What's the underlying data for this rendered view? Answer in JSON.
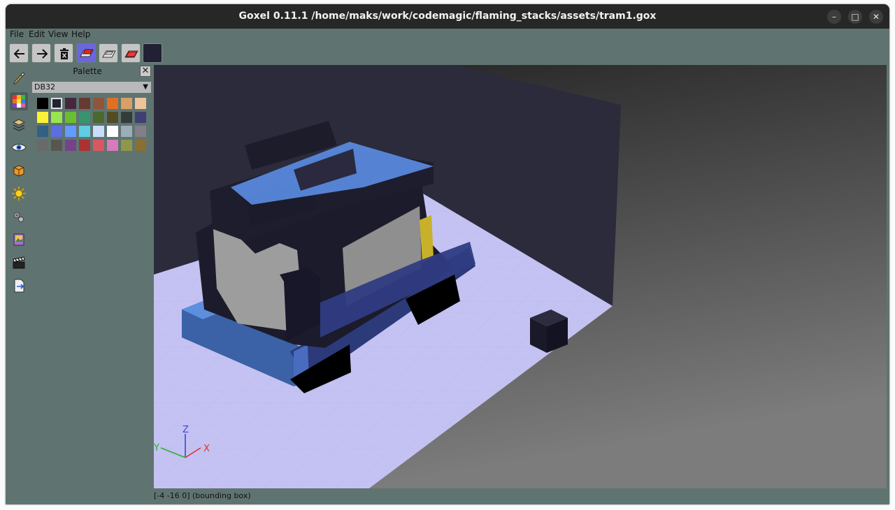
{
  "window": {
    "title": "Goxel 0.11.1 /home/maks/work/codemagic/flaming_stacks/assets/tram1.gox"
  },
  "window_controls": {
    "minimize": "–",
    "maximize": "□",
    "close": "✕"
  },
  "menu": [
    "File",
    "Edit",
    "View",
    "Help"
  ],
  "toolbar": {
    "items": [
      {
        "name": "undo",
        "icon": "arrow-left-icon"
      },
      {
        "name": "redo",
        "icon": "arrow-right-icon"
      },
      {
        "name": "delete",
        "icon": "trash-icon"
      },
      {
        "name": "add-mode",
        "icon": "add-brush-icon",
        "active": true
      },
      {
        "name": "subtract-mode",
        "icon": "eraser-icon"
      },
      {
        "name": "paint-mode",
        "icon": "paint-brush-icon"
      }
    ],
    "current_color": "#222034"
  },
  "sidebar": {
    "items": [
      {
        "name": "tools",
        "icon": "brush-icon"
      },
      {
        "name": "palette",
        "icon": "palette-icon",
        "active": true
      },
      {
        "name": "layers",
        "icon": "layers-icon"
      },
      {
        "name": "view",
        "icon": "eye-icon"
      },
      {
        "name": "material",
        "icon": "cube-icon"
      },
      {
        "name": "light",
        "icon": "sun-icon"
      },
      {
        "name": "export",
        "icon": "gears-icon"
      },
      {
        "name": "image",
        "icon": "image-icon"
      },
      {
        "name": "animation",
        "icon": "clapper-icon"
      },
      {
        "name": "save-export",
        "icon": "file-export-icon"
      }
    ]
  },
  "palette": {
    "title": "Palette",
    "close": "✕",
    "selected_palette": "DB32",
    "selected_index": 1,
    "colors": [
      "#000000",
      "#222034",
      "#45283c",
      "#663931",
      "#8f563b",
      "#df7126",
      "#d9a066",
      "#eec39a",
      "#fbf236",
      "#99e550",
      "#6abe30",
      "#37946e",
      "#4b692f",
      "#524b24",
      "#323c39",
      "#3f3f74",
      "#306082",
      "#5b6ee1",
      "#639bff",
      "#5fcde4",
      "#cbdbfc",
      "#ffffff",
      "#9badb7",
      "#847e87",
      "#696a6a",
      "#595652",
      "#76428a",
      "#ac3232",
      "#d95763",
      "#d77bba",
      "#8f974a",
      "#8a6f30"
    ]
  },
  "axes": {
    "z": "Z",
    "x": "X",
    "y": "Y"
  },
  "status": "[-4 -16 0] (bounding box)"
}
